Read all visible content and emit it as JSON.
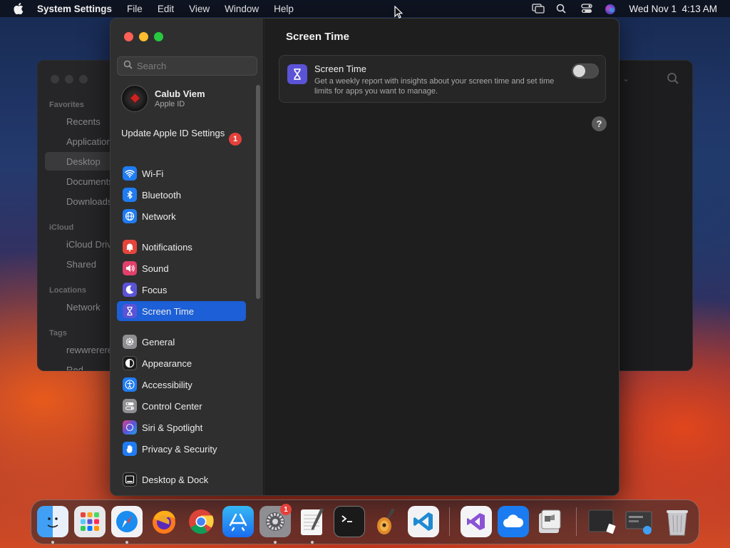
{
  "menubar": {
    "app_name": "System Settings",
    "menus": [
      "File",
      "Edit",
      "View",
      "Window",
      "Help"
    ],
    "clock": "Wed Nov 1  4:13 AM"
  },
  "finder": {
    "sections": [
      {
        "title": "Favorites",
        "items": [
          "Recents",
          "Applications",
          "Desktop",
          "Documents",
          "Downloads"
        ]
      },
      {
        "title": "iCloud",
        "items": [
          "iCloud Drive",
          "Shared"
        ]
      },
      {
        "title": "Locations",
        "items": [
          "Network"
        ]
      },
      {
        "title": "Tags",
        "items": [
          "rewwrerere",
          "Red"
        ]
      }
    ],
    "selected_item": "Desktop"
  },
  "settings": {
    "search_placeholder": "Search",
    "account": {
      "name": "Calub Viem",
      "subtitle": "Apple ID"
    },
    "update": {
      "label": "Update Apple ID Settings",
      "badge": "1"
    },
    "nav": [
      {
        "label": "Wi-Fi",
        "icon": "wifi-icon",
        "color": "#1f7cf2"
      },
      {
        "label": "Bluetooth",
        "icon": "bluetooth-icon",
        "color": "#1f7cf2"
      },
      {
        "label": "Network",
        "icon": "globe-icon",
        "color": "#1f7cf2"
      },
      {
        "label": "Notifications",
        "icon": "bell-icon",
        "color": "#e5453d"
      },
      {
        "label": "Sound",
        "icon": "speaker-icon",
        "color": "#e0406a"
      },
      {
        "label": "Focus",
        "icon": "moon-icon",
        "color": "#5b53d6"
      },
      {
        "label": "Screen Time",
        "icon": "hourglass-icon",
        "color": "#5b53d6"
      },
      {
        "label": "General",
        "icon": "gear-icon",
        "color": "#8e8e93"
      },
      {
        "label": "Appearance",
        "icon": "appearance-icon",
        "color": "#1c1c1e"
      },
      {
        "label": "Accessibility",
        "icon": "accessibility-icon",
        "color": "#1f7cf2"
      },
      {
        "label": "Control Center",
        "icon": "control-center-icon",
        "color": "#8e8e93"
      },
      {
        "label": "Siri & Spotlight",
        "icon": "siri-icon",
        "color": "#b33ac9"
      },
      {
        "label": "Privacy & Security",
        "icon": "hand-icon",
        "color": "#1f7cf2"
      },
      {
        "label": "Desktop & Dock",
        "icon": "dock-icon",
        "color": "#1c1c1e"
      }
    ],
    "selected": "Screen Time",
    "pane": {
      "title": "Screen Time",
      "card_title": "Screen Time",
      "card_description": "Get a weekly report with insights about your screen time and set time limits for apps you want to manage.",
      "toggle_on": false,
      "help_label": "?"
    }
  },
  "dock": {
    "apps": [
      "Finder",
      "Launchpad",
      "Safari",
      "Firefox",
      "Google Chrome",
      "App Store",
      "System Settings",
      "TextEdit",
      "Terminal",
      "GarageBand",
      "Visual Studio Code",
      "Visual Studio",
      "iCloud",
      "Boot Camp Assistant",
      "Desktop Stack",
      "Screenshot Folder",
      "Trash"
    ],
    "system_settings_badge": "1"
  }
}
